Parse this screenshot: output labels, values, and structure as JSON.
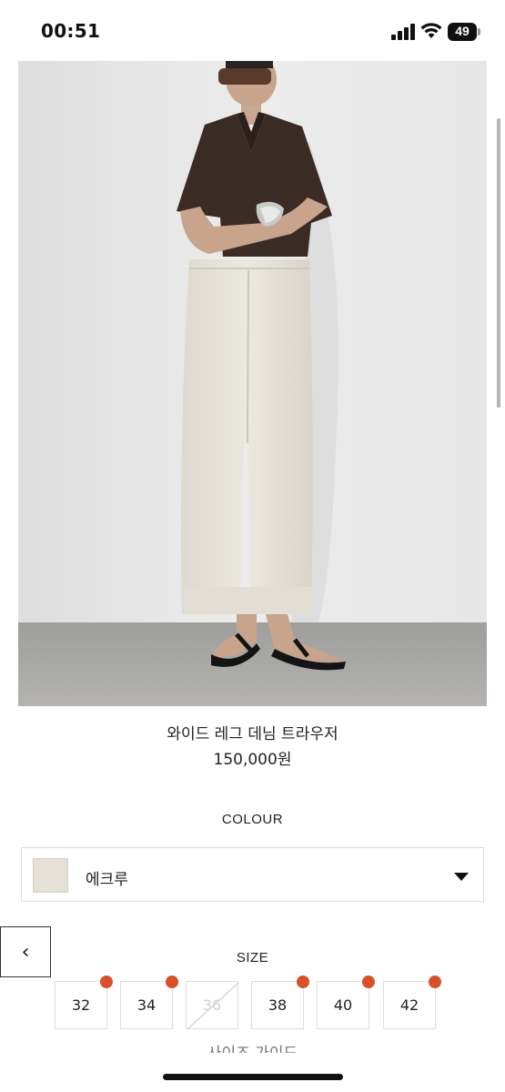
{
  "status_bar": {
    "time": "00:51",
    "battery": "49"
  },
  "product": {
    "title": "와이드 레그 데님 트라우저",
    "price": "150,000원",
    "image_alt": "Model wearing ecru wide-leg denim trousers with a dark brown short-sleeve shirt"
  },
  "colour": {
    "label": "COLOUR",
    "selected": "에크루",
    "swatch_color": "#e5e1d6"
  },
  "navigation": {
    "back_icon": "‹"
  },
  "size": {
    "label": "SIZE",
    "options": [
      {
        "label": "32",
        "available": true,
        "indicator": true
      },
      {
        "label": "34",
        "available": true,
        "indicator": true
      },
      {
        "label": "36",
        "available": false,
        "indicator": false
      },
      {
        "label": "38",
        "available": true,
        "indicator": true
      },
      {
        "label": "40",
        "available": true,
        "indicator": true
      },
      {
        "label": "42",
        "available": true,
        "indicator": true
      }
    ]
  },
  "below_fold_text": "사이즈 가이드",
  "colors": {
    "accent_dot": "#d8502a",
    "text": "#222222"
  }
}
